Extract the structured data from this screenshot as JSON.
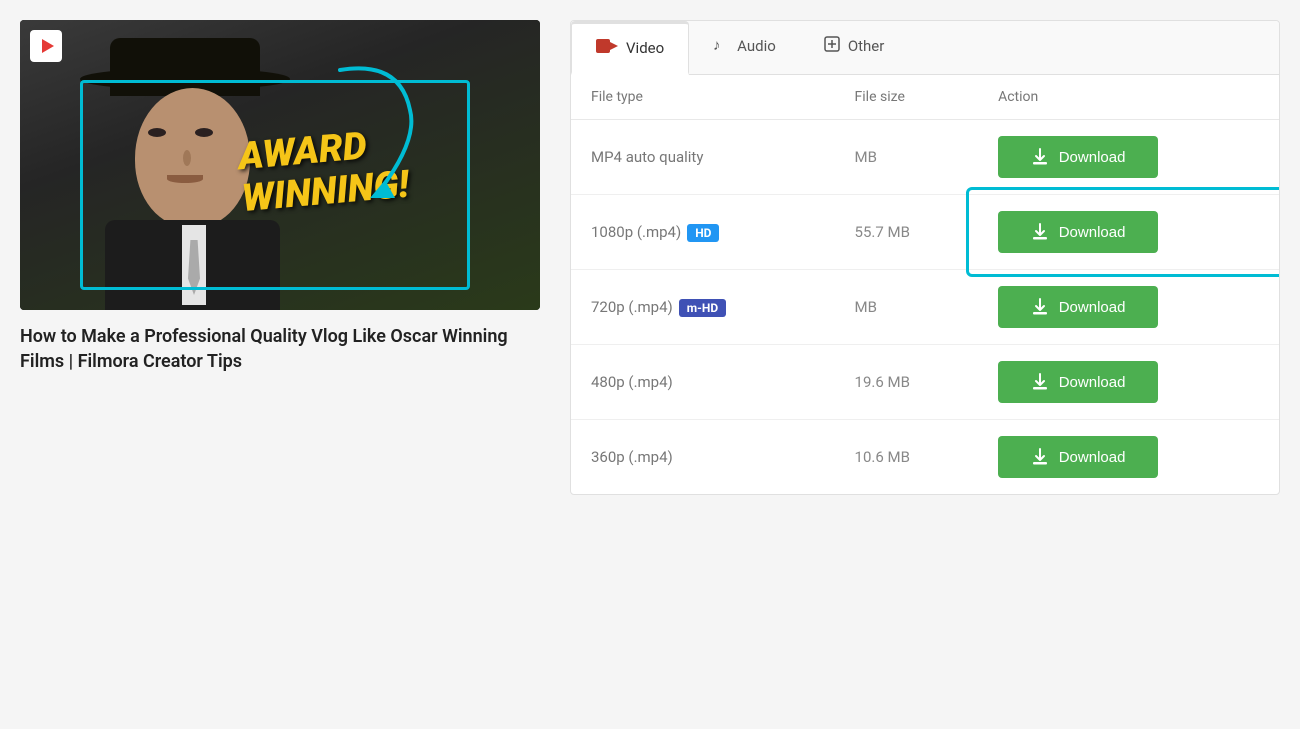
{
  "left": {
    "title": "How to Make a Professional Quality Vlog Like Oscar Winning Films | Filmora Creator Tips",
    "award_line1": "AWARD",
    "award_line2": "WINNING!"
  },
  "tabs": [
    {
      "id": "video",
      "label": "Video",
      "icon": "video-icon",
      "active": true
    },
    {
      "id": "audio",
      "label": "Audio",
      "icon": "music-icon",
      "active": false
    },
    {
      "id": "other",
      "label": "Other",
      "icon": "plus-icon",
      "active": false
    }
  ],
  "table": {
    "headers": [
      "File type",
      "File size",
      "Action"
    ],
    "rows": [
      {
        "file_type": "MP4 auto quality",
        "badge": null,
        "file_size": "MB",
        "action_label": "Download",
        "highlighted": false
      },
      {
        "file_type": "1080p (.mp4)",
        "badge": "HD",
        "badge_class": "hd",
        "file_size": "55.7 MB",
        "action_label": "Download",
        "highlighted": true
      },
      {
        "file_type": "720p (.mp4)",
        "badge": "m-HD",
        "badge_class": "mhd",
        "file_size": "MB",
        "action_label": "Download",
        "highlighted": false
      },
      {
        "file_type": "480p (.mp4)",
        "badge": null,
        "file_size": "19.6 MB",
        "action_label": "Download",
        "highlighted": false
      },
      {
        "file_type": "360p (.mp4)",
        "badge": null,
        "file_size": "10.6 MB",
        "action_label": "Download",
        "highlighted": false
      }
    ]
  }
}
